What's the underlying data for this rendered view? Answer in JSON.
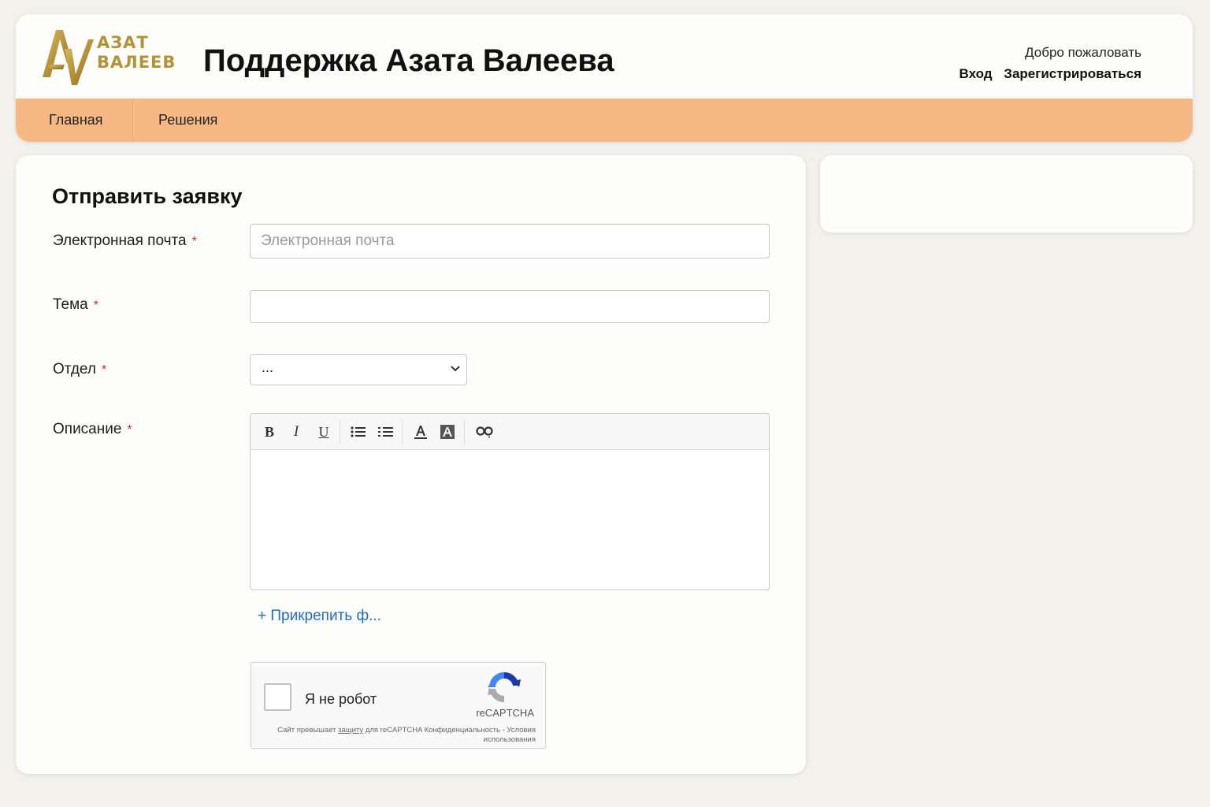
{
  "header": {
    "logo_text": "АЗАТ\nВАЛЕЕВ",
    "title": "Поддержка Азата Валеева",
    "welcome": "Добро пожаловать",
    "login": "Вход",
    "register": "Зарегистрироваться"
  },
  "nav": {
    "home": "Главная",
    "solutions": "Решения"
  },
  "form": {
    "heading": "Отправить заявку",
    "required_mark": "*",
    "email_label": "Электронная почта",
    "email_placeholder": "Электронная почта",
    "email_value": "",
    "subject_label": "Тема",
    "subject_value": "",
    "department_label": "Отдел",
    "department_value": "...",
    "description_label": "Описание",
    "attach_label": "+ Прикрепить ф..."
  },
  "editor_toolbar": {
    "bold": "B",
    "italic": "I",
    "underline": "U"
  },
  "captcha": {
    "label": "Я не робот",
    "brand": "reCAPTCHA",
    "note_before": "Сайт превышает ",
    "note_link": "защиту",
    "note_after": " для reCAPTCHA Конфиденциальность - Условия использования"
  },
  "colors": {
    "nav_bg": "#f6b986",
    "logo_gold": "#b39338",
    "required": "#d42b2b",
    "link": "#1f6cc7"
  },
  "icons": {
    "logo": "av-monogram-logo",
    "bullet_list": "bullet-list-icon",
    "numbered_list": "numbered-list-icon",
    "text_color": "text-color-icon",
    "highlight": "background-color-icon",
    "link": "link-icon",
    "dropdown": "chevron-down-icon",
    "captcha": "recaptcha-logo"
  }
}
